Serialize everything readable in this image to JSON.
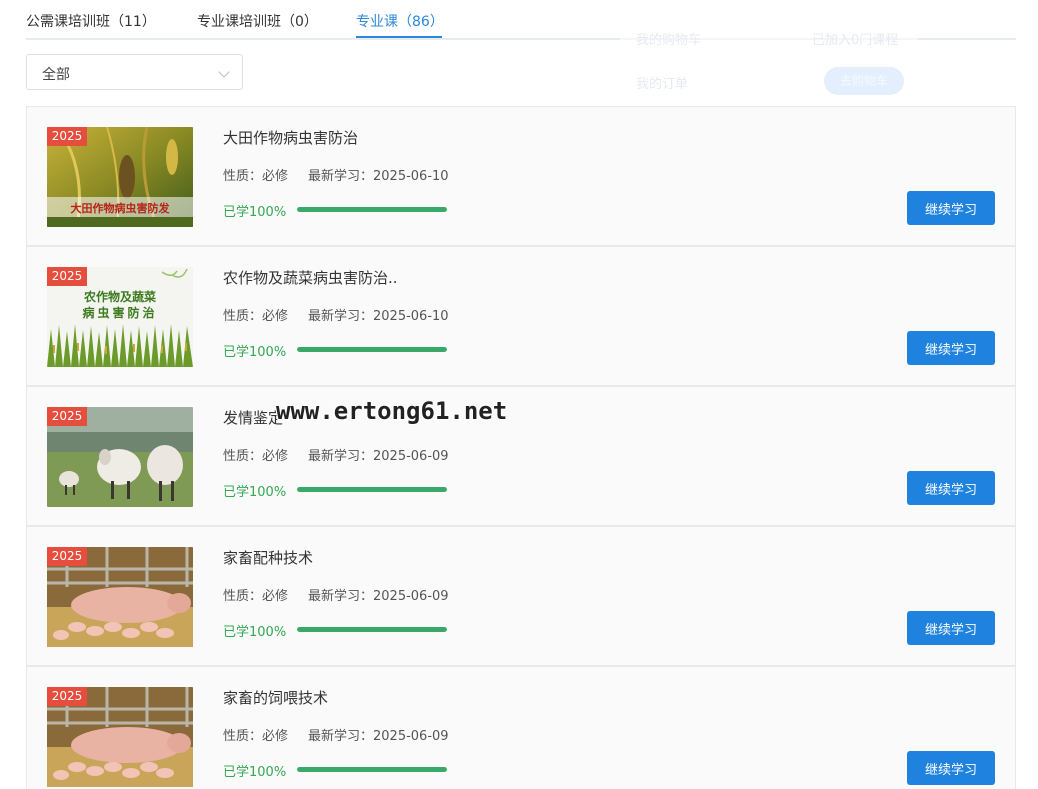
{
  "tabs": [
    {
      "label": "公需课培训班（11）",
      "active": false
    },
    {
      "label": "专业课培训班（0）",
      "active": false
    },
    {
      "label": "专业课（86）",
      "active": true
    }
  ],
  "cart": {
    "my_cart": "我的购物车",
    "added": "已加入0门课程",
    "my_orders": "我的订单",
    "go_cart": "去购物车"
  },
  "filter": {
    "selected": "全部"
  },
  "courses": [
    {
      "year": "2025",
      "title": "大田作物病虫害防治",
      "thumb_caption": "大田作物病虫害防发",
      "nature": "性质：必修",
      "latest": "最新学习：2025-06-10",
      "progress_label": "已学100%",
      "progress": 100,
      "button": "继续学习"
    },
    {
      "year": "2025",
      "title": "农作物及蔬菜病虫害防治..",
      "thumb_caption_1": "农作物及蔬菜",
      "thumb_caption_2": "病虫害防治",
      "nature": "性质：必修",
      "latest": "最新学习：2025-06-10",
      "progress_label": "已学100%",
      "progress": 100,
      "button": "继续学习"
    },
    {
      "year": "2025",
      "title": "发情鉴定",
      "nature": "性质：必修",
      "latest": "最新学习：2025-06-09",
      "progress_label": "已学100%",
      "progress": 100,
      "button": "继续学习"
    },
    {
      "year": "2025",
      "title": "家畜配种技术",
      "nature": "性质：必修",
      "latest": "最新学习：2025-06-09",
      "progress_label": "已学100%",
      "progress": 100,
      "button": "继续学习"
    },
    {
      "year": "2025",
      "title": "家畜的饲喂技术",
      "nature": "性质：必修",
      "latest": "最新学习：2025-06-09",
      "progress_label": "已学100%",
      "progress": 100,
      "button": "继续学习"
    }
  ],
  "watermark": "www.ertong61.net",
  "colors": {
    "accent": "#2d88d9",
    "button": "#1e82de",
    "progress": "#3aa86b",
    "badge": "#e54d3c"
  }
}
